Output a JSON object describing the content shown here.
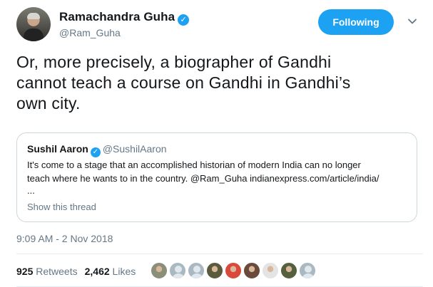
{
  "author": {
    "name": "Ramachandra Guha",
    "handle": "@Ram_Guha",
    "verified_icon": "verified-badge-icon"
  },
  "follow_button": {
    "label": "Following",
    "color": "#1da1f2"
  },
  "tweet": {
    "text_line1": "Or, more precisely, a biographer of Gandhi",
    "text_line2": "cannot teach a course on Gandhi in Gandhi’s",
    "text_line3": "own city."
  },
  "quoted_tweet": {
    "name": "Sushil Aaron",
    "handle": "@SushilAaron",
    "text_line1": "It's come to a stage that an accomplished historian of modern India can no longer",
    "text_line2": "teach where he wants to in the country. @Ram_Guha indianexpress.com/article/india/",
    "ellipsis": "...",
    "show_thread": "Show this thread"
  },
  "timestamp": "9:09 AM - 2 Nov 2018",
  "stats": {
    "retweets_count": "925",
    "retweets_label": "Retweets",
    "likes_count": "2,462",
    "likes_label": "Likes"
  },
  "likers": [
    {
      "kind": "photo",
      "color": "#8b8f7a"
    },
    {
      "kind": "default"
    },
    {
      "kind": "default"
    },
    {
      "kind": "photo",
      "color": "#5b5a3c"
    },
    {
      "kind": "photo",
      "color": "#d94a3a"
    },
    {
      "kind": "photo",
      "color": "#6b4a3c"
    },
    {
      "kind": "photo",
      "color": "#e4e4e4"
    },
    {
      "kind": "photo",
      "color": "#55603e"
    },
    {
      "kind": "default"
    }
  ],
  "colors": {
    "accent": "#1da1f2",
    "text": "#14171a",
    "secondary": "#657786",
    "border": "#ccd6dd"
  }
}
